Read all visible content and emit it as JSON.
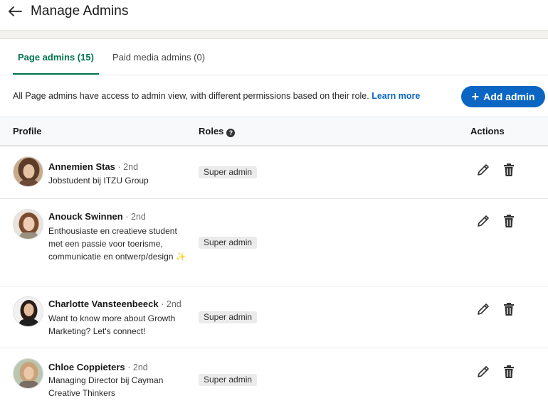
{
  "header": {
    "title": "Manage Admins"
  },
  "tabs": [
    {
      "label": "Page admins (15)",
      "active": true
    },
    {
      "label": "Paid media admins (0)",
      "active": false
    }
  ],
  "info": {
    "text": "All Page admins have access to admin view, with different permissions based on their role. ",
    "link": "Learn more"
  },
  "add_button": {
    "label": "Add admin"
  },
  "columns": {
    "profile": "Profile",
    "roles": "Roles",
    "actions": "Actions"
  },
  "colors": {
    "primary": "#0a66c2",
    "tab_active": "#01754f"
  },
  "admins": [
    {
      "name": "Annemien Stas",
      "degree": "· 2nd",
      "headline": "Jobstudent bij ITZU Group",
      "role": "Super admin"
    },
    {
      "name": "Anouck Swinnen",
      "degree": "· 2nd",
      "headline": "Enthousiaste en creatieve student met een passie voor toerisme, communicatie en ontwerp/design ✨",
      "role": "Super admin"
    },
    {
      "name": "Charlotte Vansteenbeeck",
      "degree": "· 2nd",
      "headline": "Want to know more about Growth Marketing? Let's connect!",
      "role": "Super admin"
    },
    {
      "name": "Chloe Coppieters",
      "degree": "· 2nd",
      "headline": "Managing Director bij Cayman Creative Thinkers",
      "role": "Super admin"
    }
  ]
}
